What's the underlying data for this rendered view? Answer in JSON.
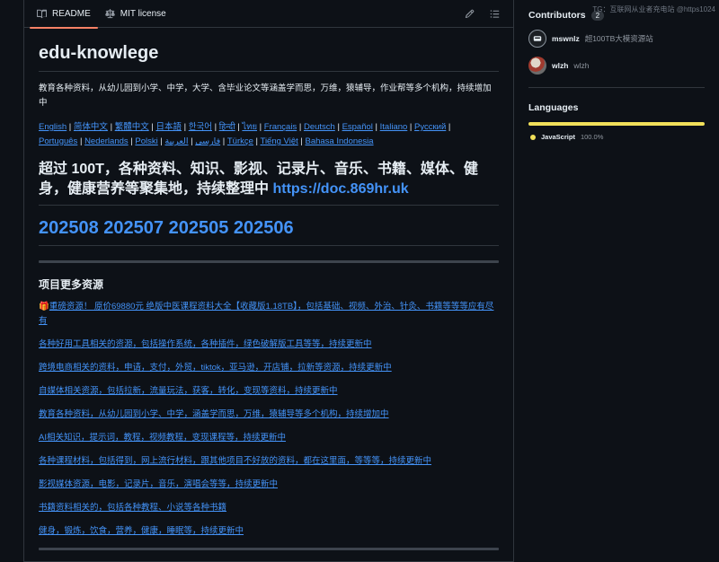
{
  "tabs": {
    "readme": "README",
    "license": "MIT license"
  },
  "readme": {
    "title": "edu-knowlege",
    "description": "教育各种资料，从幼儿园到小学、中学，大学、含毕业论文等涵盖学而思，万维，猿辅导，作业帮等多个机构，持续增加中",
    "languages": [
      "English",
      "简体中文",
      "繁體中文",
      "日本語",
      "한국어",
      "हिन्दी",
      "ไทย",
      "Français",
      "Deutsch",
      "Español",
      "Italiano",
      "Русский",
      "Português",
      "Nederlands",
      "Polski",
      "فارسی",
      "العربية",
      "Türkçe",
      "Tiếng Việt",
      "Bahasa Indonesia"
    ],
    "headline": "超过 100T，各种资料、知识、影视、记录片、音乐、书籍、媒体、健身，健康营养等聚集地，持续整理中",
    "headline_link": "https://doc.869hr.uk",
    "dates": "202508 202507 202505 202506",
    "section_title": "项目更多资源",
    "gift_icon": "🎁",
    "resources": [
      "重磅资源！ 原价69880元 绝版中医课程资料大全【收藏版1.18TB】，包括基础、视频、外治、针灸、书籍等等等应有尽有",
      "各种好用工具相关的资源，包括操作系统，各种插件，绿色破解版工具等等，持续更新中",
      "跨境电商相关的资料，申请，支付，外贸，tiktok，亚马逊，开店铺，拉新等资源，持续更新中",
      "自媒体相关资源，包括拉新，流量玩法，获客，转化，变现等资料，持续更新中",
      "教育各种资料，从幼儿园到小学、中学，涵盖学而思，万维，猿辅导等多个机构，持续增加中",
      "AI相关知识，提示词，教程，视频教程，变现课程等，持续更新中",
      "各种课程材料，包括得到，网上流行材料，跟其他项目不好放的资料，都在这里面，等等等，持续更新中",
      "影视媒体资源，电影，记录片，音乐，演唱会等等，持续更新中",
      "书籍资料相关的，包括各种教程、小说等各种书籍",
      "健身，锻炼，饮食，营养，健康，睡眠等，持续更新中"
    ]
  },
  "sidebar": {
    "contributors_title": "Contributors",
    "contributors_count": "2",
    "watermark": "TG：互联网从业者充电站 @https1024",
    "contributors": [
      {
        "name": "mswnlz",
        "desc": "超100TB大模资源站"
      },
      {
        "name": "wlzh",
        "desc": "wlzh"
      }
    ],
    "languages_title": "Languages",
    "language_name": "JavaScript",
    "language_pct": "100.0%",
    "language_percent_value": 100,
    "language_color": "#f1e05a"
  }
}
